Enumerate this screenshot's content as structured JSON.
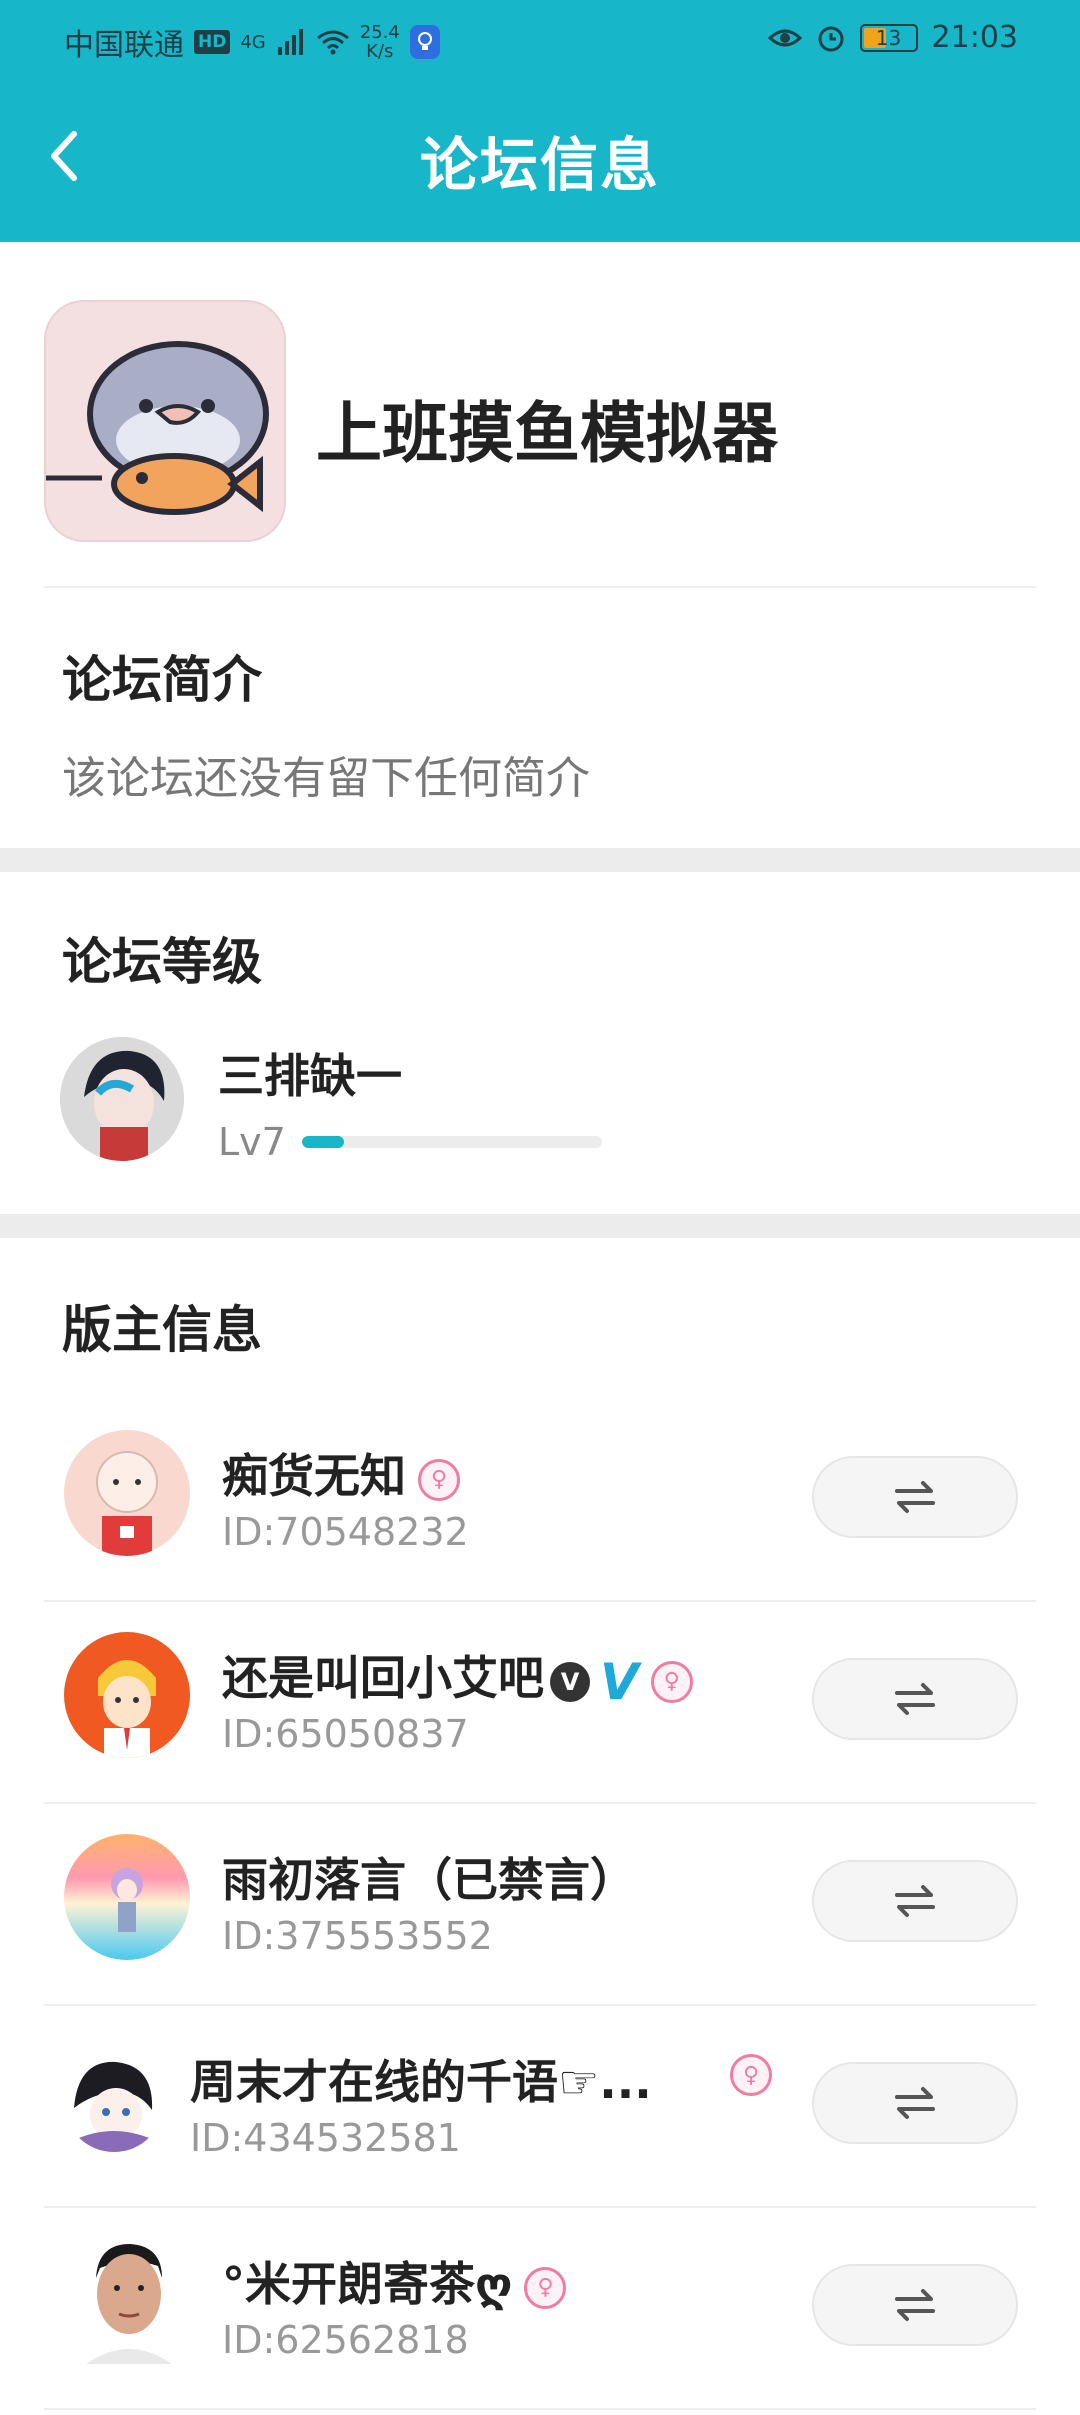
{
  "status_bar": {
    "carrier": "中国联通",
    "hd": "HD",
    "net_type": "4G",
    "speed_value": "25.4",
    "speed_unit": "K/s",
    "battery": "13",
    "time": "21:03"
  },
  "header": {
    "title": "论坛信息"
  },
  "forum": {
    "name": "上班摸鱼模拟器"
  },
  "intro": {
    "title": "论坛简介",
    "text": "该论坛还没有留下任何简介"
  },
  "level": {
    "title": "论坛等级",
    "user": "三排缺一",
    "label": "Lv7",
    "progress": 0.14
  },
  "moderators": {
    "title": "版主信息",
    "items": [
      {
        "name": "痴货无知",
        "id": "ID:70548232"
      },
      {
        "name": "还是叫回小艾吧",
        "id": "ID:65050837"
      },
      {
        "name": "雨初落言（已禁言）",
        "id": "ID:375553552"
      },
      {
        "name": "周末才在线的千语☞...",
        "id": "ID:434532581"
      },
      {
        "name": "°米开朗寄茶ღ",
        "id": "ID:62562818"
      }
    ]
  },
  "icons": {
    "back": "chevron-left-icon",
    "swap": "swap-arrows-icon"
  },
  "colors": {
    "header": "#17b6c8",
    "progress": "#17b6c8",
    "badge": "#f07da0"
  }
}
